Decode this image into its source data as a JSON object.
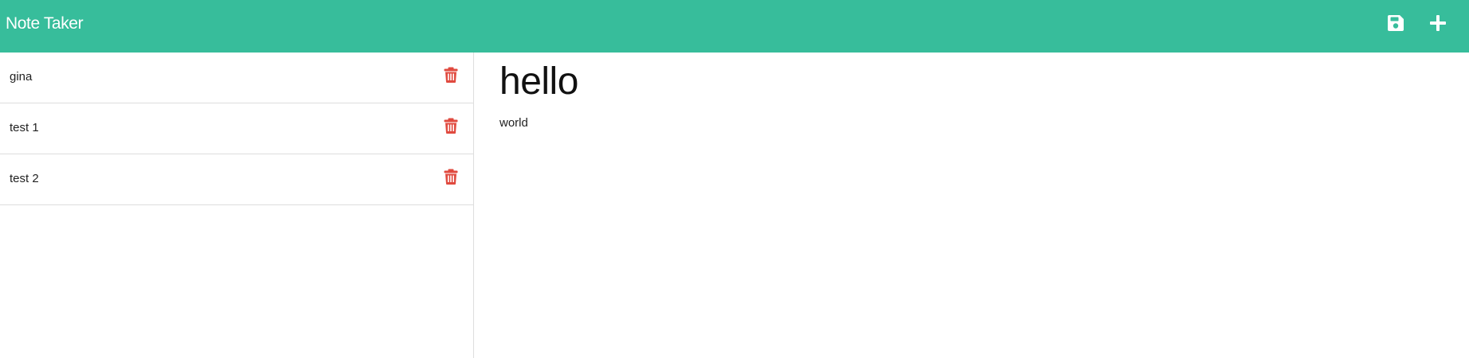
{
  "app": {
    "title": "Note Taker",
    "accent_color": "#37bd9b",
    "delete_color": "#e04a3f"
  },
  "toolbar": {
    "save_icon": "save-icon",
    "add_icon": "plus-icon"
  },
  "notes": [
    {
      "title": "gina",
      "icon": "trash-icon"
    },
    {
      "title": "test 1",
      "icon": "trash-icon"
    },
    {
      "title": "test 2",
      "icon": "trash-icon"
    }
  ],
  "active_note": {
    "title": "hello",
    "text": "world"
  }
}
